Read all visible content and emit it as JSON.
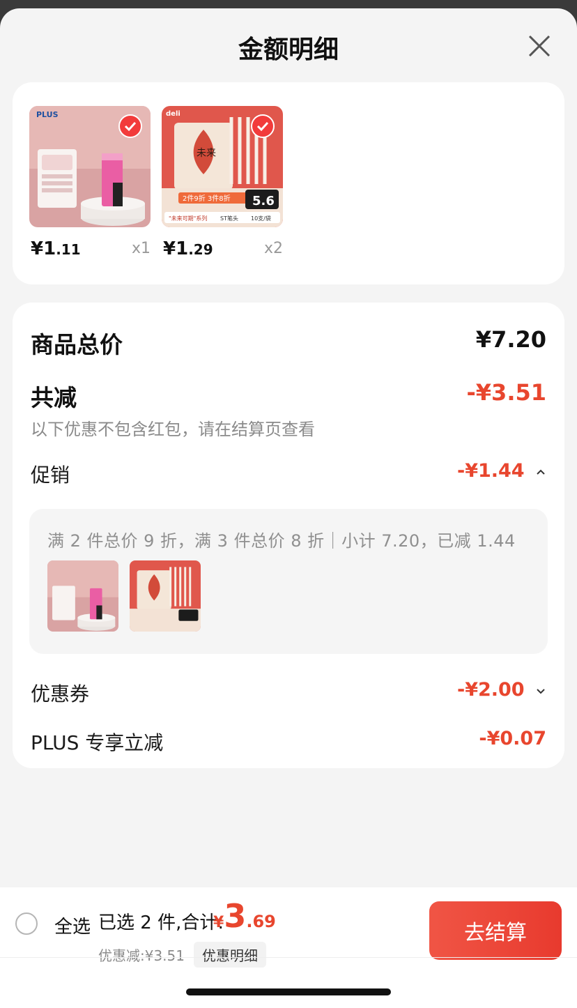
{
  "sheet": {
    "title": "金额明细"
  },
  "products": [
    {
      "price_int": "¥1",
      "price_dec": ".11",
      "qty": "x1",
      "brand": "PLUS"
    },
    {
      "price_int": "¥1",
      "price_dec": ".29",
      "qty": "x2",
      "brand": "deli",
      "promo_banner": "2件9折 3件8折",
      "series": "\"未来可期\"系列",
      "tip": "ST笔头",
      "pack": "10支/袋",
      "big_price": "5.6"
    }
  ],
  "summary": {
    "total_label": "商品总价",
    "total_value": "¥7.20",
    "reduce_label": "共减",
    "reduce_value": "-¥3.51",
    "reduce_note": "以下优惠不包含红包，请在结算页查看",
    "promo_label": "促销",
    "promo_value": "-¥1.44",
    "promo_text": "满 2 件总价 9 折，满 3 件总价 8 折｜小计 7.20，已减 1.44",
    "coupon_label": "优惠券",
    "coupon_value": "-¥2.00",
    "plus_label": "PLUS 专享立减",
    "plus_value": "-¥0.07"
  },
  "bottom": {
    "select_all": "全选",
    "selected_text": "已选 2 件,合计:",
    "total_yen": "¥",
    "total_int": "3",
    "total_dec": ".69",
    "saved_text": "优惠减:¥3.51",
    "detail_link": "优惠明细",
    "checkout": "去结算"
  },
  "colors": {
    "accent": "#e8462e",
    "button": "#ef4a3c",
    "check": "#f23b3b"
  }
}
